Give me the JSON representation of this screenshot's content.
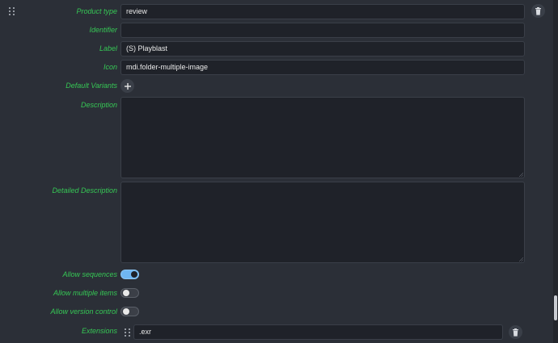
{
  "fields": {
    "product_type": {
      "label": "Product type",
      "value": "review"
    },
    "identifier": {
      "label": "Identifier",
      "value": ""
    },
    "label": {
      "label": "Label",
      "value": "(S) Playblast"
    },
    "icon": {
      "label": "Icon",
      "value": "mdi.folder-multiple-image"
    },
    "default_variants": {
      "label": "Default Variants"
    },
    "description": {
      "label": "Description",
      "value": ""
    },
    "detailed_description": {
      "label": "Detailed Description",
      "value": ""
    },
    "allow_sequences": {
      "label": "Allow sequences",
      "on": true
    },
    "allow_multiple_items": {
      "label": "Allow multiple items",
      "on": false
    },
    "allow_version_control": {
      "label": "Allow version control",
      "on": false
    },
    "extensions": {
      "label": "Extensions",
      "items": [
        ".exr"
      ]
    }
  },
  "icons": {
    "drag": "drag-handle-icon",
    "delete": "trash-icon",
    "add": "plus-icon"
  },
  "colors": {
    "label_green": "#36c755",
    "toggle_on": "#6fb6f2",
    "background": "#2b2f37",
    "field_bg": "#1f2229"
  }
}
